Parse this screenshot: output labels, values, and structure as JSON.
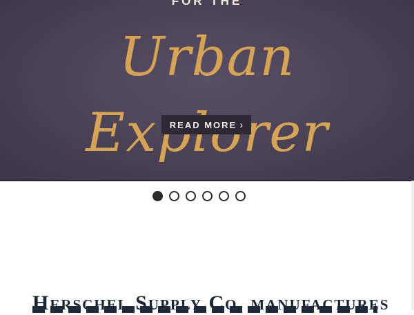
{
  "hero": {
    "eyebrow": "FOR THE",
    "title": "Urban Explorer",
    "cta_label": "READ MORE",
    "cta_icon": "chevron-right-icon",
    "background_color": "#4b4155",
    "title_color": "#d6a457"
  },
  "carousel": {
    "slide_count": 6,
    "active_index": 0
  },
  "intro": {
    "heading": "Herschel Supply Co. manufactures"
  }
}
